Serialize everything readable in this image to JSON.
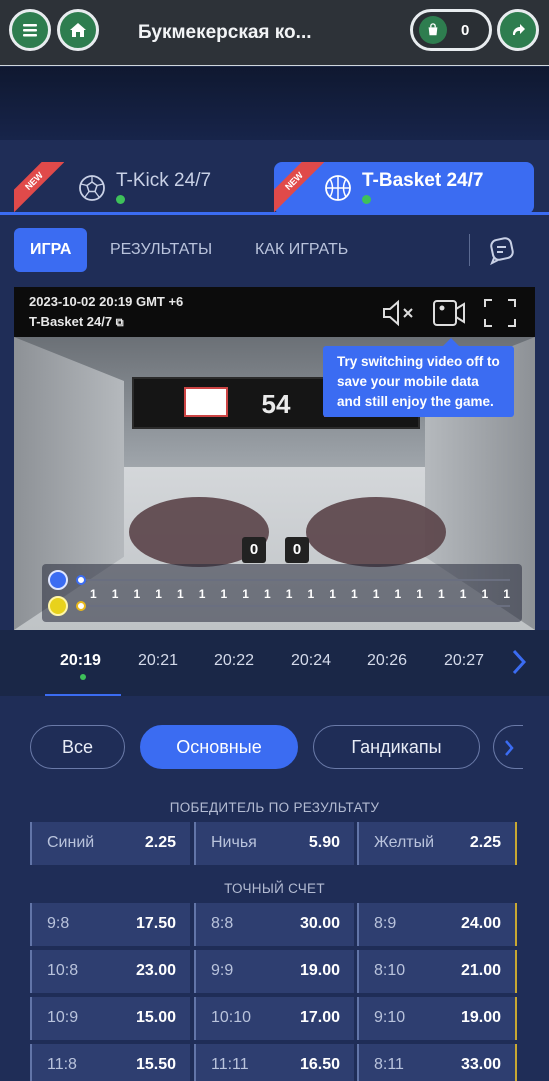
{
  "header": {
    "title": "Букмекерская ко...",
    "cart_count": "0"
  },
  "game_tabs": [
    {
      "badge": "NEW",
      "name": "T-Kick 24/7"
    },
    {
      "badge": "NEW",
      "name": "T-Basket 24/7"
    }
  ],
  "nav": {
    "game": "ИГРА",
    "results": "РЕЗУЛЬТАТЫ",
    "how_to_play": "КАК ИГРАТЬ"
  },
  "video": {
    "timestamp": "2023-10-02 20:19 GMT +6",
    "game_name": "T-Basket 24/7",
    "scoreboard": "54",
    "home_score": "0",
    "away_score": "0",
    "tooltip": "Try switching video off to save your mobile data and still enjoy the game.",
    "timeline_marks": [
      "1",
      "1",
      "1",
      "1",
      "1",
      "1",
      "1",
      "1",
      "1",
      "1",
      "1",
      "1",
      "1",
      "1",
      "1",
      "1",
      "1",
      "1",
      "1",
      "1"
    ]
  },
  "time_slots": [
    "20:19",
    "20:21",
    "20:22",
    "20:24",
    "20:26",
    "20:27"
  ],
  "filters": {
    "all": "Все",
    "main": "Основные",
    "handicaps": "Гандикапы"
  },
  "winner_market": {
    "title": "ПОБЕДИТЕЛЬ ПО РЕЗУЛЬТАТУ",
    "odds": [
      {
        "label": "Синий",
        "value": "2.25"
      },
      {
        "label": "Ничья",
        "value": "5.90"
      },
      {
        "label": "Желтый",
        "value": "2.25"
      }
    ]
  },
  "exact_score_market": {
    "title": "ТОЧНЫЙ СЧЕТ",
    "rows": [
      [
        {
          "label": "9:8",
          "value": "17.50"
        },
        {
          "label": "8:8",
          "value": "30.00"
        },
        {
          "label": "8:9",
          "value": "24.00"
        }
      ],
      [
        {
          "label": "10:8",
          "value": "23.00"
        },
        {
          "label": "9:9",
          "value": "19.00"
        },
        {
          "label": "8:10",
          "value": "21.00"
        }
      ],
      [
        {
          "label": "10:9",
          "value": "15.00"
        },
        {
          "label": "10:10",
          "value": "17.00"
        },
        {
          "label": "9:10",
          "value": "19.00"
        }
      ],
      [
        {
          "label": "11:8",
          "value": "15.50"
        },
        {
          "label": "11:11",
          "value": "16.50"
        },
        {
          "label": "8:11",
          "value": "33.00"
        }
      ]
    ]
  },
  "colors": {
    "accent": "#3b6cf2",
    "panel": "#1f2d57",
    "odd_cell": "#2e3e70",
    "green": "#2e7d4f",
    "live_dot": "#3ec15a"
  }
}
